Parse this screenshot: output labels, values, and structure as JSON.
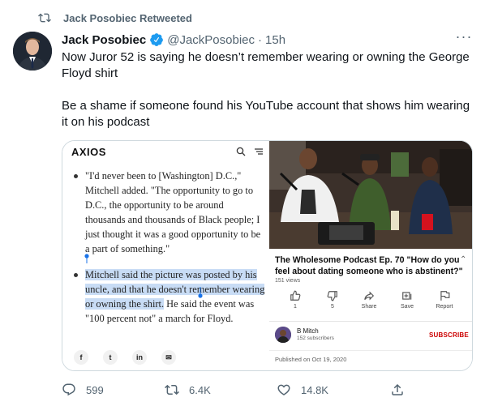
{
  "retweet": {
    "label": "Jack Posobiec Retweeted",
    "icon": "retweet-icon"
  },
  "author": {
    "name": "Jack Posobiec",
    "handle": "@JackPosobiec",
    "separator": "·",
    "time": "15h",
    "verified_icon": "verified-badge-icon"
  },
  "more": {
    "label": "···",
    "icon": "more-icon"
  },
  "tweet": {
    "paragraphs": [
      "Now Juror 52 is saying he doesn’t remember wearing or owning the George Floyd shirt",
      "Be a shame if someone found his YouTube account that shows him wearing it on his podcast"
    ]
  },
  "axios": {
    "logo": "AXIOS",
    "bullet1": "\"I'd never been to [Washington] D.C.,\" Mitchell added. \"The opportunity to go to D.C., the opportunity to be around thousands and thousands of Black people; I just thought it was a good opportunity to be a part of something.\"",
    "bullet2_highlight": "Mitchell said the picture was posted by his uncle, and that he doesn't remember wearing or owning the shirt.",
    "bullet2_rest": " He said the event was \"100 percent not\" a march for Floyd.",
    "share": [
      "f",
      "t",
      "in",
      "✉"
    ]
  },
  "youtube": {
    "title": "The Wholesome Podcast Ep. 70 \"How do you feel about dating someone who is abstinent?\"",
    "views": "151 views",
    "actions": [
      {
        "label": "1",
        "icon": "thumbs-up-icon"
      },
      {
        "label": "5",
        "icon": "thumbs-down-icon"
      },
      {
        "label": "Share",
        "icon": "share-icon"
      },
      {
        "label": "Save",
        "icon": "save-icon"
      },
      {
        "label": "Report",
        "icon": "flag-icon"
      }
    ],
    "channel": {
      "name": "B Mitch",
      "subscribers": "152 subscribers"
    },
    "subscribe_label": "SUBSCRIBE",
    "published": "Published on Oct 19, 2020"
  },
  "actions": {
    "replies": "599",
    "retweets": "6.4K",
    "likes": "14.8K"
  },
  "colors": {
    "secondary": "#536471",
    "text": "#0f1419",
    "verified": "#1d9bf0",
    "border": "#cfd9de",
    "yt_red": "#cc0000",
    "highlight": "#c8dcf5"
  }
}
